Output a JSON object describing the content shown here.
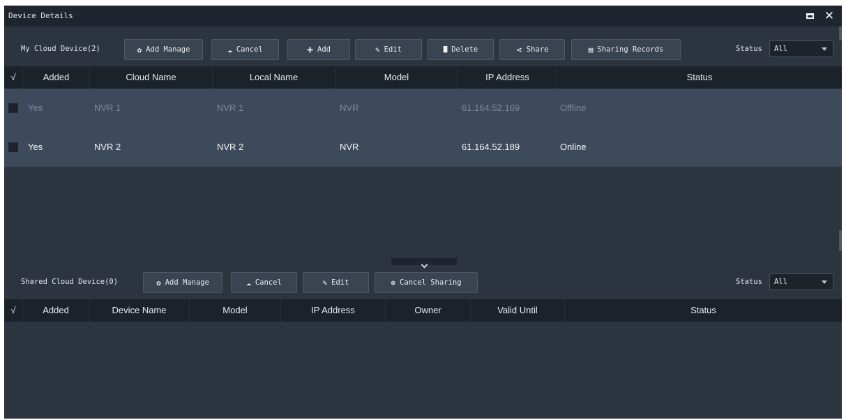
{
  "window": {
    "title": "Device Details",
    "maximize_icon": "maximize-icon",
    "close_icon": "close-icon"
  },
  "my_cloud": {
    "label": "My Cloud Device(2)",
    "buttons": [
      {
        "icon": "gear-icon",
        "glyph": "✿",
        "label": "Add Manage"
      },
      {
        "icon": "cloud-cancel-icon",
        "glyph": "☁",
        "label": "Cancel"
      },
      {
        "icon": "plus-icon",
        "glyph": "+",
        "label": "Add"
      },
      {
        "icon": "pencil-icon",
        "glyph": "✎",
        "label": "Edit"
      },
      {
        "icon": "trash-icon",
        "glyph": "▇",
        "label": "Delete"
      },
      {
        "icon": "share-icon",
        "glyph": "⋖",
        "label": "Share"
      },
      {
        "icon": "records-icon",
        "glyph": "▤",
        "label": "Sharing Records"
      }
    ],
    "status_label": "Status",
    "status_value": "All",
    "columns": [
      "√",
      "Added",
      "Cloud Name",
      "Local Name",
      "Model",
      "IP Address",
      "Status"
    ],
    "rows": [
      {
        "added": "Yes",
        "cloud_name": "NVR 1",
        "local_name": "NVR 1",
        "model": "NVR",
        "ip": "61.164.52.169",
        "status": "Offline"
      },
      {
        "added": "Yes",
        "cloud_name": "NVR 2",
        "local_name": "NVR 2",
        "model": "NVR",
        "ip": "61.164.52.189",
        "status": "Online"
      }
    ]
  },
  "shared_cloud": {
    "label": "Shared Cloud Device(0)",
    "buttons": [
      {
        "icon": "gear-icon",
        "glyph": "✿",
        "label": "Add Manage"
      },
      {
        "icon": "cloud-cancel-icon",
        "glyph": "☁",
        "label": "Cancel"
      },
      {
        "icon": "pencil-icon",
        "glyph": "✎",
        "label": "Edit"
      },
      {
        "icon": "cancel-circle-icon",
        "glyph": "⊗",
        "label": "Cancel Sharing"
      }
    ],
    "status_label": "Status",
    "status_value": "All",
    "columns": [
      "√",
      "Added",
      "Device Name",
      "Model",
      "IP Address",
      "Owner",
      "Valid Until",
      "Status"
    ],
    "rows": []
  },
  "colors": {
    "window_bg": "#2c3440",
    "titlebar_bg": "#1e252e",
    "header_bg": "#1c222a",
    "row_bg": "#3c4a5b",
    "dim_text": "#7d8a9a"
  }
}
